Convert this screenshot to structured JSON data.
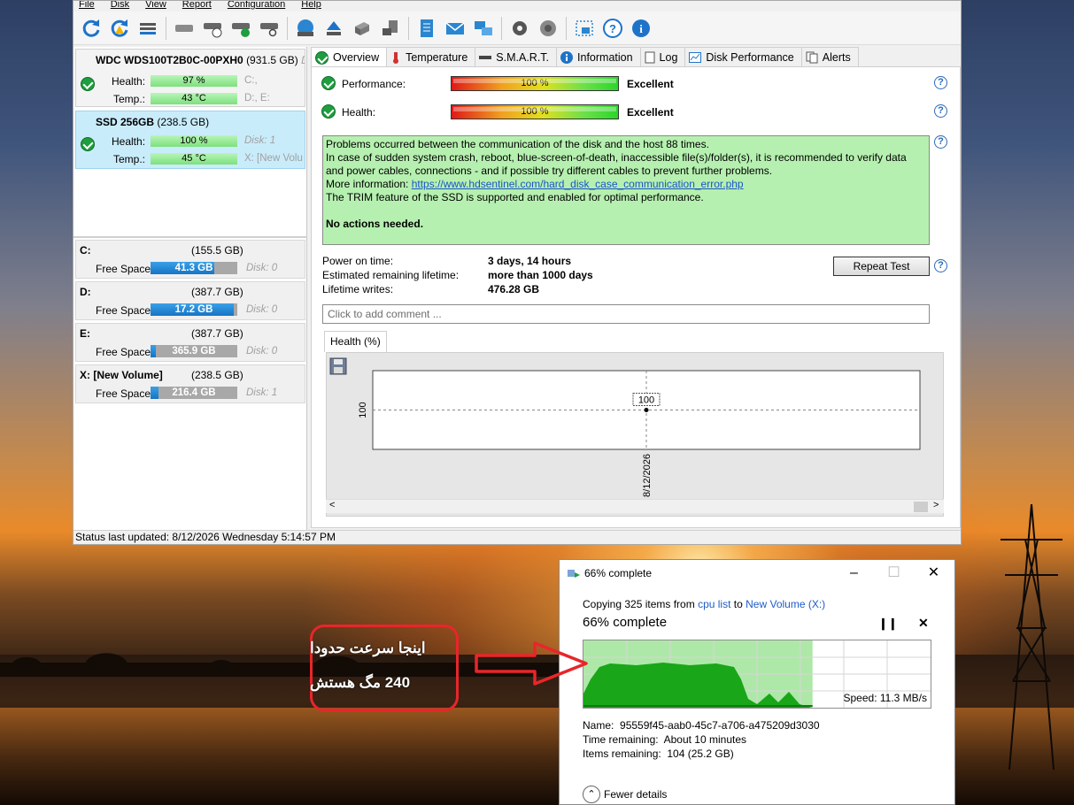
{
  "menu": [
    "File",
    "Disk",
    "View",
    "Report",
    "Configuration",
    "Help"
  ],
  "toolbar_icons": [
    "refresh-icon",
    "refresh-warning-icon",
    "disk-list-icon",
    "disk-gray-icon",
    "disk-clock-icon",
    "disk-check-icon",
    "disk-search-icon",
    "globe-disk-icon",
    "eject-icon",
    "server-icon",
    "network-disk-icon",
    "report-icon",
    "mail-icon",
    "network-icon",
    "gear-icon",
    "speaker-icon",
    "screenshot-icon",
    "help-icon",
    "info-icon"
  ],
  "disks": [
    {
      "name": "WDC WDS100T2B0C-00PXH0",
      "size": "(931.5 GB)",
      "trail": "Di",
      "health_label": "Health:",
      "health": "97 %",
      "health_level": 0.97,
      "health_extra": "C:,",
      "temp_label": "Temp.:",
      "temp": "43 °C",
      "temp_extra": "D:, E:"
    },
    {
      "name": "SSD 256GB",
      "size": "(238.5 GB)",
      "health_label": "Health:",
      "health": "100 %",
      "health_level": 1.0,
      "health_extra": "Disk: 1",
      "temp_label": "Temp.:",
      "temp": "45 °C",
      "temp_extra": "X: [New Volu"
    }
  ],
  "volumes": [
    {
      "name": "C:",
      "size": "(155.5 GB)",
      "free_label": "Free Space",
      "free": "41.3 GB",
      "used_fraction": 0.73,
      "disk": "Disk: 0"
    },
    {
      "name": "D:",
      "size": "(387.7 GB)",
      "free_label": "Free Space",
      "free": "17.2 GB",
      "used_fraction": 0.96,
      "disk": "Disk: 0"
    },
    {
      "name": "E:",
      "size": "(387.7 GB)",
      "free_label": "Free Space",
      "free": "365.9 GB",
      "used_fraction": 0.06,
      "disk": "Disk: 0"
    },
    {
      "name": "X: [New Volume]",
      "size": "(238.5 GB)",
      "free_label": "Free Space",
      "free": "216.4 GB",
      "used_fraction": 0.09,
      "disk": "Disk: 1"
    }
  ],
  "tabs": [
    "Overview",
    "Temperature",
    "S.M.A.R.T.",
    "Information",
    "Log",
    "Disk Performance",
    "Alerts"
  ],
  "overview": {
    "performance_label": "Performance:",
    "performance_value": "100 %",
    "performance_rating": "Excellent",
    "health_label": "Health:",
    "health_value": "100 %",
    "health_rating": "Excellent",
    "info_lines": [
      "Problems occurred between the communication of the disk and the host 88 times.",
      "In case of sudden system crash, reboot, blue-screen-of-death, inaccessible file(s)/folder(s), it is recommended to verify data and power cables, connections - and if possible try different cables to prevent further problems."
    ],
    "more_info_label": "More information:",
    "more_info_link": "https://www.hdsentinel.com/hard_disk_case_communication_error.php",
    "trim_line": "The TRIM feature of the SSD is supported and enabled for optimal performance.",
    "no_actions": "No actions needed.",
    "power_on_label": "Power on time:",
    "power_on_value": "3 days, 14 hours",
    "remaining_label": "Estimated remaining lifetime:",
    "remaining_value": "more than 1000 days",
    "writes_label": "Lifetime writes:",
    "writes_value": "476.28 GB",
    "repeat_test": "Repeat Test",
    "comment_placeholder": "Click to add comment ..."
  },
  "chart_data": {
    "type": "scatter",
    "tab_label": "Health (%)",
    "x": [
      "8/12/2026"
    ],
    "values": [
      100
    ],
    "point_label": "100",
    "ytick": "100",
    "grid": true
  },
  "status": "Status last updated: 8/12/2026 Wednesday 5:14:57 PM",
  "copy_dialog": {
    "title": "66% complete",
    "copying_prefix": "Copying 325 items from",
    "source": "cpu list",
    "to_word": "to",
    "destination": "New Volume (X:)",
    "percent_text": "66% complete",
    "progress": 0.66,
    "speed": "Speed: 11.3 MB/s",
    "name_label": "Name:",
    "name_value": "95559f45-aab0-45c7-a706-a475209d3030",
    "time_label": "Time remaining:",
    "time_value": "About 10 minutes",
    "items_label": "Items remaining:",
    "items_value": "104 (25.2 GB)",
    "fewer_details": "Fewer details"
  },
  "annotation": {
    "line1": "اینجا سرعت حدودا",
    "line2": "240 مگ هستش",
    "color": "#e8262a"
  }
}
